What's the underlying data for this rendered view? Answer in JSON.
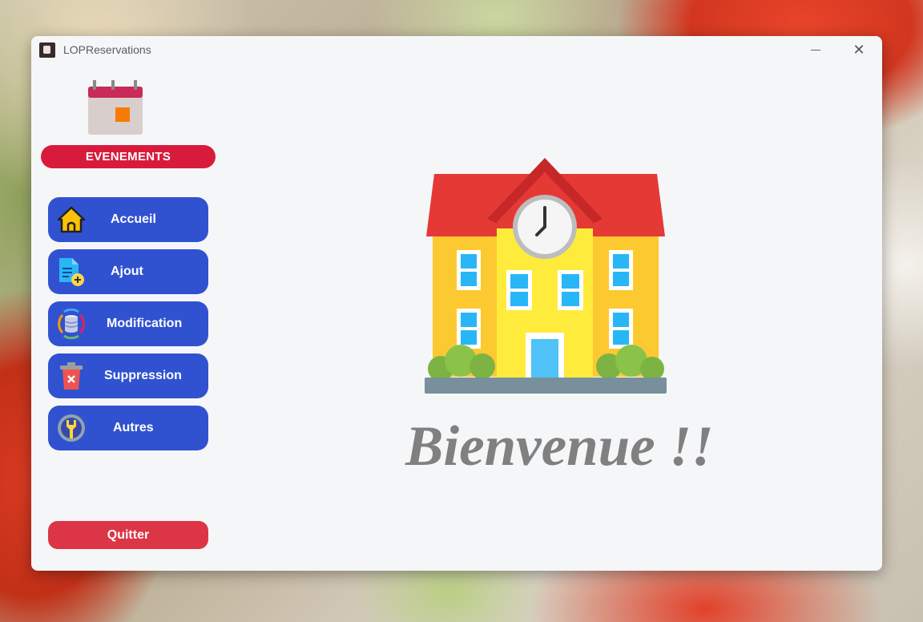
{
  "window": {
    "title": "LOPReservations",
    "minimize_glyph": "",
    "close_glyph": "✕"
  },
  "sidebar": {
    "events_label": "EVENEMENTS",
    "items": [
      {
        "label": "Accueil",
        "icon": "house-icon"
      },
      {
        "label": "Ajout",
        "icon": "add-document-icon"
      },
      {
        "label": "Modification",
        "icon": "database-sync-icon"
      },
      {
        "label": "Suppression",
        "icon": "trash-icon"
      },
      {
        "label": "Autres",
        "icon": "settings-wrench-icon"
      }
    ],
    "quit_label": "Quitter"
  },
  "main": {
    "welcome_text": "Bienvenue !!",
    "illustration": "school-building-icon"
  },
  "colors": {
    "events": "#d81b3d",
    "nav": "#3152d0",
    "quit": "#dc3545",
    "welcome": "#808080",
    "background": "#f5f6f8"
  }
}
